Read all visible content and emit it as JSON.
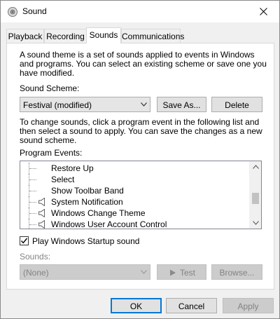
{
  "window": {
    "title": "Sound",
    "close_glyph": "✕"
  },
  "tabs": [
    {
      "label": "Playback"
    },
    {
      "label": "Recording"
    },
    {
      "label": "Sounds"
    },
    {
      "label": "Communications"
    }
  ],
  "sounds": {
    "description": [
      "A sound theme is a set of sounds applied to events in Windows",
      "and programs.  You can select an existing scheme or save one you",
      "have modified."
    ],
    "scheme_label": "Sound Scheme:",
    "scheme_value": "Festival (modified)",
    "save_as_label": "Save As...",
    "delete_label": "Delete",
    "instructions": [
      "To change sounds, click a program event in the following list and",
      "then select a sound to apply.  You can save the changes as a new",
      "sound scheme."
    ],
    "events_label": "Program Events:",
    "events": [
      {
        "label": "Restore Up",
        "has_sound": false
      },
      {
        "label": "Select",
        "has_sound": false
      },
      {
        "label": "Show Toolbar Band",
        "has_sound": false
      },
      {
        "label": "System Notification",
        "has_sound": true
      },
      {
        "label": "Windows Change Theme",
        "has_sound": true
      },
      {
        "label": "Windows User Account Control",
        "has_sound": true
      }
    ],
    "startup_checkbox_label": "Play Windows Startup sound",
    "startup_checked": true,
    "sounds_label": "Sounds:",
    "sound_value": "(None)",
    "test_label": "Test",
    "browse_label": "Browse..."
  },
  "footer": {
    "ok_label": "OK",
    "cancel_label": "Cancel",
    "apply_label": "Apply"
  },
  "colors": {
    "accent": "#0078d7",
    "disabled_text": "#838383"
  }
}
